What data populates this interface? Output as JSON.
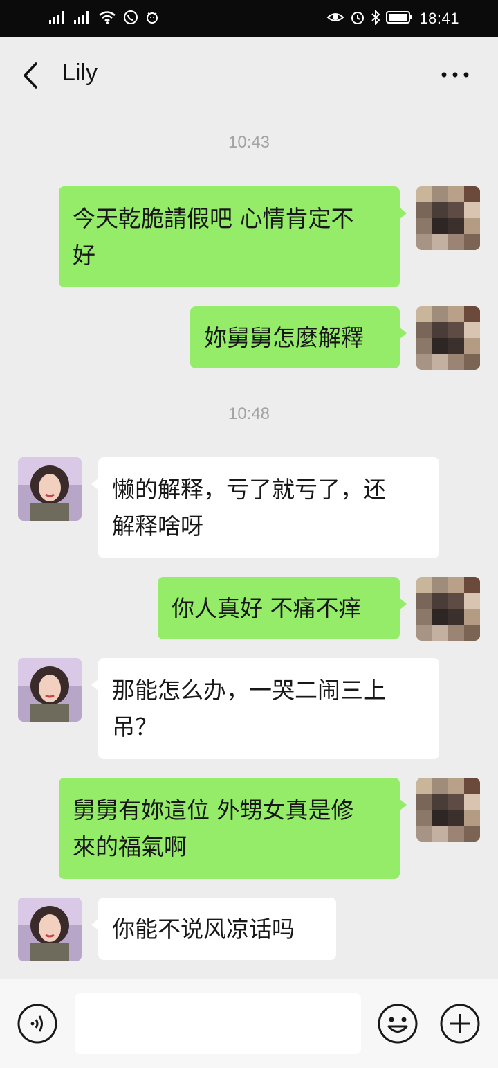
{
  "status_bar": {
    "time": "18:41",
    "left_icons": [
      "signal-1-icon",
      "signal-2-icon",
      "wifi-icon",
      "whatsapp-icon",
      "notification-icon"
    ],
    "right_icons": [
      "eye-icon",
      "alarm-icon",
      "bluetooth-icon",
      "battery-icon"
    ]
  },
  "header": {
    "back_icon": "chevron-left-icon",
    "title": "Lily",
    "more_icon": "more-dots-icon"
  },
  "messages": [
    {
      "type": "time",
      "text": "10:43"
    },
    {
      "type": "msg",
      "from": "me",
      "lines": [
        "今天乾脆請假吧 心情肯定不",
        "好"
      ]
    },
    {
      "type": "msg",
      "from": "me",
      "lines": [
        "妳舅舅怎麼解釋"
      ]
    },
    {
      "type": "time",
      "text": "10:48"
    },
    {
      "type": "msg",
      "from": "them",
      "lines": [
        "懒的解释，亏了就亏了，还",
        "解释啥呀"
      ]
    },
    {
      "type": "msg",
      "from": "me",
      "lines": [
        "你人真好 不痛不痒"
      ]
    },
    {
      "type": "msg",
      "from": "them",
      "lines": [
        "那能怎么办，一哭二闹三上",
        "吊？"
      ]
    },
    {
      "type": "msg",
      "from": "me",
      "lines": [
        "舅舅有妳這位 外甥女真是修",
        "來的福氣啊"
      ]
    },
    {
      "type": "msg",
      "from": "them",
      "lines": [
        "你能不说风凉话吗"
      ]
    }
  ],
  "input_bar": {
    "voice_icon": "voice-icon",
    "emoji_icon": "emoji-icon",
    "add_icon": "add-icon",
    "input_value": ""
  },
  "colors": {
    "my_bubble": "#95ec69",
    "their_bubble": "#ffffff",
    "background": "#ededed"
  }
}
